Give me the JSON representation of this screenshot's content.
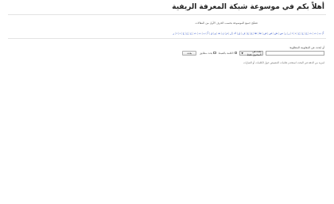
{
  "header": {
    "title": "أهلاً بكم في موسوعة شبكة المعرفة الريفية"
  },
  "intro": {
    "text": "تصفّح جميع الموسوعة بحسب الحرف الأول من المقالات"
  },
  "alphabet": {
    "letters": [
      "أ",
      "ب",
      "ت",
      "ث",
      "ج",
      "ح",
      "خ",
      "د",
      "ذ",
      "ر",
      "ز",
      "س",
      "ش",
      "ص",
      "ض",
      "ط",
      "ظ",
      "ع",
      "غ",
      "ف",
      "ق",
      "ك",
      "ل",
      "م",
      "ن",
      "هـ",
      "و",
      "ي",
      "أ",
      "ب",
      "ت",
      "ث",
      "ج",
      "ح",
      "خ",
      "د",
      "ذ",
      "ر"
    ]
  },
  "search": {
    "label": "أو ابحث عن المعلومة المطلوبة:",
    "input_value": "",
    "select_value": "بحث في المحتوى فقط",
    "checkbox1_label": "الكلمة بالضبط",
    "checkbox2_label": "بحث مطابق",
    "button_label": "بحث",
    "note": "لمزيد من الدقة في البحث استخدم علامات التنصيص حول الكلمات أو العبارات"
  },
  "icons": {
    "select_chevron": "chevron-down-icon"
  }
}
